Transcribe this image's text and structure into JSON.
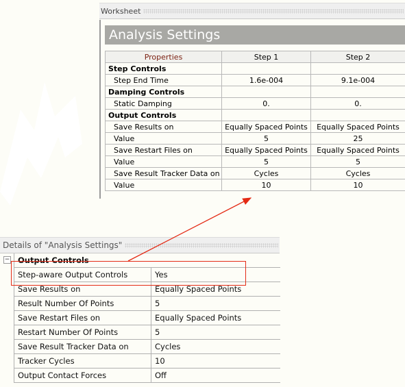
{
  "worksheet": {
    "header": "Worksheet",
    "title": "Analysis Settings",
    "columns": [
      "Properties",
      "Step 1",
      "Step 2"
    ],
    "rows": [
      {
        "type": "group",
        "label": "Step Controls",
        "values": [
          "",
          ""
        ]
      },
      {
        "type": "item",
        "label": "Step End Time",
        "values": [
          "1.6e-004",
          "9.1e-004"
        ]
      },
      {
        "type": "group",
        "label": "Damping Controls",
        "values": [
          "",
          ""
        ]
      },
      {
        "type": "item",
        "label": "Static Damping",
        "values": [
          "0.",
          "0."
        ]
      },
      {
        "type": "group",
        "label": "Output Controls",
        "values": [
          "",
          ""
        ]
      },
      {
        "type": "item",
        "label": "Save Results on",
        "values": [
          "Equally Spaced Points",
          "Equally Spaced Points"
        ]
      },
      {
        "type": "item",
        "label": "Value",
        "values": [
          "5",
          "25"
        ]
      },
      {
        "type": "item",
        "label": "Save Restart Files on",
        "values": [
          "Equally Spaced Points",
          "Equally Spaced Points"
        ]
      },
      {
        "type": "item",
        "label": "Value",
        "values": [
          "5",
          "5"
        ]
      },
      {
        "type": "item",
        "label": "Save Result Tracker Data on",
        "values": [
          "Cycles",
          "Cycles"
        ]
      },
      {
        "type": "item",
        "label": "Value",
        "values": [
          "10",
          "10"
        ]
      }
    ]
  },
  "details": {
    "header": "Details of \"Analysis Settings\"",
    "collapse_glyph": "−",
    "group": "Output Controls",
    "rows": [
      {
        "label": "Step-aware Output Controls",
        "value": "Yes",
        "highlighted": true
      },
      {
        "label": "Save Results on",
        "value": "Equally Spaced Points"
      },
      {
        "label": "Result Number Of Points",
        "value": "5"
      },
      {
        "label": "Save Restart Files on",
        "value": "Equally Spaced Points"
      },
      {
        "label": "Restart Number Of Points",
        "value": "5"
      },
      {
        "label": "Save Result Tracker Data on",
        "value": "Cycles"
      },
      {
        "label": "Tracker Cycles",
        "value": "10"
      },
      {
        "label": "Output Contact Forces",
        "value": "Off"
      }
    ]
  },
  "annotation": {
    "color": "#e42a14"
  }
}
